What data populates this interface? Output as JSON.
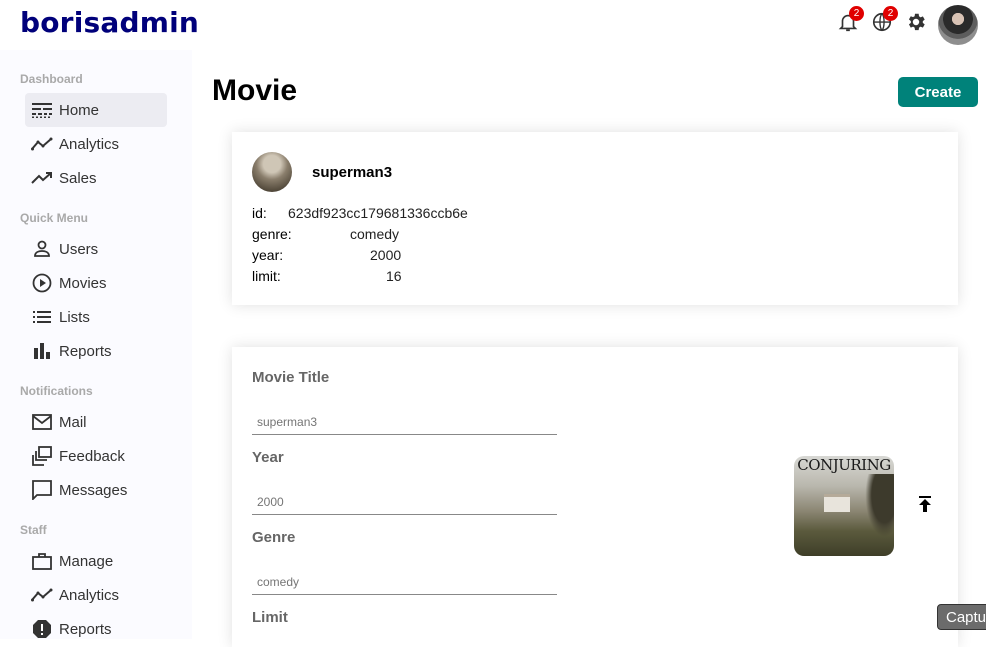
{
  "app": {
    "logo": "borisadmin"
  },
  "topbar": {
    "notifications_badge": "2",
    "language_badge": "2"
  },
  "sidebar": {
    "sections": [
      {
        "title": "Dashboard",
        "items": [
          {
            "label": "Home",
            "icon": "line-style-icon"
          },
          {
            "label": "Analytics",
            "icon": "timeline-icon"
          },
          {
            "label": "Sales",
            "icon": "trending-up-icon"
          }
        ]
      },
      {
        "title": "Quick Menu",
        "items": [
          {
            "label": "Users",
            "icon": "person-outline-icon"
          },
          {
            "label": "Movies",
            "icon": "play-circle-icon"
          },
          {
            "label": "Lists",
            "icon": "list-icon"
          },
          {
            "label": "Reports",
            "icon": "bar-chart-icon"
          }
        ]
      },
      {
        "title": "Notifications",
        "items": [
          {
            "label": "Mail",
            "icon": "mail-outline-icon"
          },
          {
            "label": "Feedback",
            "icon": "dynamic-feed-icon"
          },
          {
            "label": "Messages",
            "icon": "chat-bubble-outline-icon"
          }
        ]
      },
      {
        "title": "Staff",
        "items": [
          {
            "label": "Manage",
            "icon": "work-outline-icon"
          },
          {
            "label": "Analytics",
            "icon": "timeline-icon"
          },
          {
            "label": "Reports",
            "icon": "report-icon"
          }
        ]
      }
    ]
  },
  "main": {
    "title": "Movie",
    "create_label": "Create",
    "info": {
      "name": "superman3",
      "rows": [
        {
          "key": "id:",
          "value": "623df923cc179681336ccb6e"
        },
        {
          "key": "genre:",
          "value": "comedy"
        },
        {
          "key": "year:",
          "value": "2000"
        },
        {
          "key": "limit:",
          "value": "16"
        }
      ]
    },
    "form": {
      "fields": [
        {
          "label": "Movie Title",
          "placeholder": "superman3"
        },
        {
          "label": "Year",
          "placeholder": "2000"
        },
        {
          "label": "Genre",
          "placeholder": "comedy"
        },
        {
          "label": "Limit",
          "placeholder": ""
        }
      ],
      "poster_text": "CONJURING"
    }
  },
  "capture": {
    "label": "Captu"
  },
  "colors": {
    "accent": "#00827a",
    "logo": "#00007a",
    "badge": "#e00000"
  }
}
